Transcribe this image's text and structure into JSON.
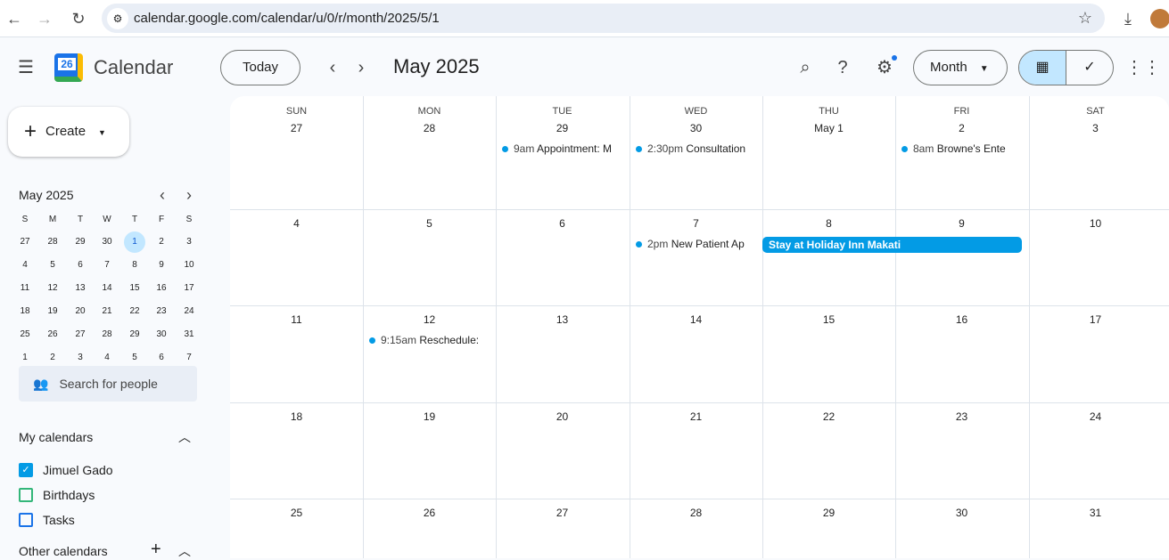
{
  "browser": {
    "url": "calendar.google.com/calendar/u/0/r/month/2025/5/1"
  },
  "app": {
    "logo_day": "26",
    "name": "Calendar",
    "today": "Today",
    "title": "May 2025",
    "view": "Month",
    "create": "Create"
  },
  "mini": {
    "title": "May 2025",
    "dows": [
      "S",
      "M",
      "T",
      "W",
      "T",
      "F",
      "S"
    ],
    "days": [
      "27",
      "28",
      "29",
      "30",
      "1",
      "2",
      "3",
      "4",
      "5",
      "6",
      "7",
      "8",
      "9",
      "10",
      "11",
      "12",
      "13",
      "14",
      "15",
      "16",
      "17",
      "18",
      "19",
      "20",
      "21",
      "22",
      "23",
      "24",
      "25",
      "26",
      "27",
      "28",
      "29",
      "30",
      "31",
      "1",
      "2",
      "3",
      "4",
      "5",
      "6",
      "7"
    ],
    "selected_index": 4
  },
  "search_people": "Search for people",
  "my_calendars": {
    "label": "My calendars",
    "items": [
      {
        "name": "Jimuel Gado",
        "color": "#039be5",
        "checked": true
      },
      {
        "name": "Birthdays",
        "color": "#33b679",
        "checked": false
      },
      {
        "name": "Tasks",
        "color": "#1a73e8",
        "checked": false
      }
    ]
  },
  "other_calendars": "Other calendars",
  "grid": {
    "dows": [
      "SUN",
      "MON",
      "TUE",
      "WED",
      "THU",
      "FRI",
      "SAT"
    ],
    "days": [
      "27",
      "28",
      "29",
      "30",
      "May 1",
      "2",
      "3",
      "4",
      "5",
      "6",
      "7",
      "8",
      "9",
      "10",
      "11",
      "12",
      "13",
      "14",
      "15",
      "16",
      "17",
      "18",
      "19",
      "20",
      "21",
      "22",
      "23",
      "24",
      "25",
      "26",
      "27",
      "28",
      "29",
      "30",
      "31"
    ],
    "events": [
      {
        "cell": 2,
        "time": "9am",
        "title": "Appointment: M"
      },
      {
        "cell": 3,
        "time": "2:30pm",
        "title": "Consultation"
      },
      {
        "cell": 5,
        "time": "8am",
        "title": "Browne's Ente"
      },
      {
        "cell": 10,
        "time": "2pm",
        "title": "New Patient Ap"
      },
      {
        "cell": 15,
        "time": "9:15am",
        "title": "Reschedule:"
      }
    ],
    "allday": {
      "title": "Stay at Holiday Inn Makati",
      "color": "#039be5"
    }
  }
}
